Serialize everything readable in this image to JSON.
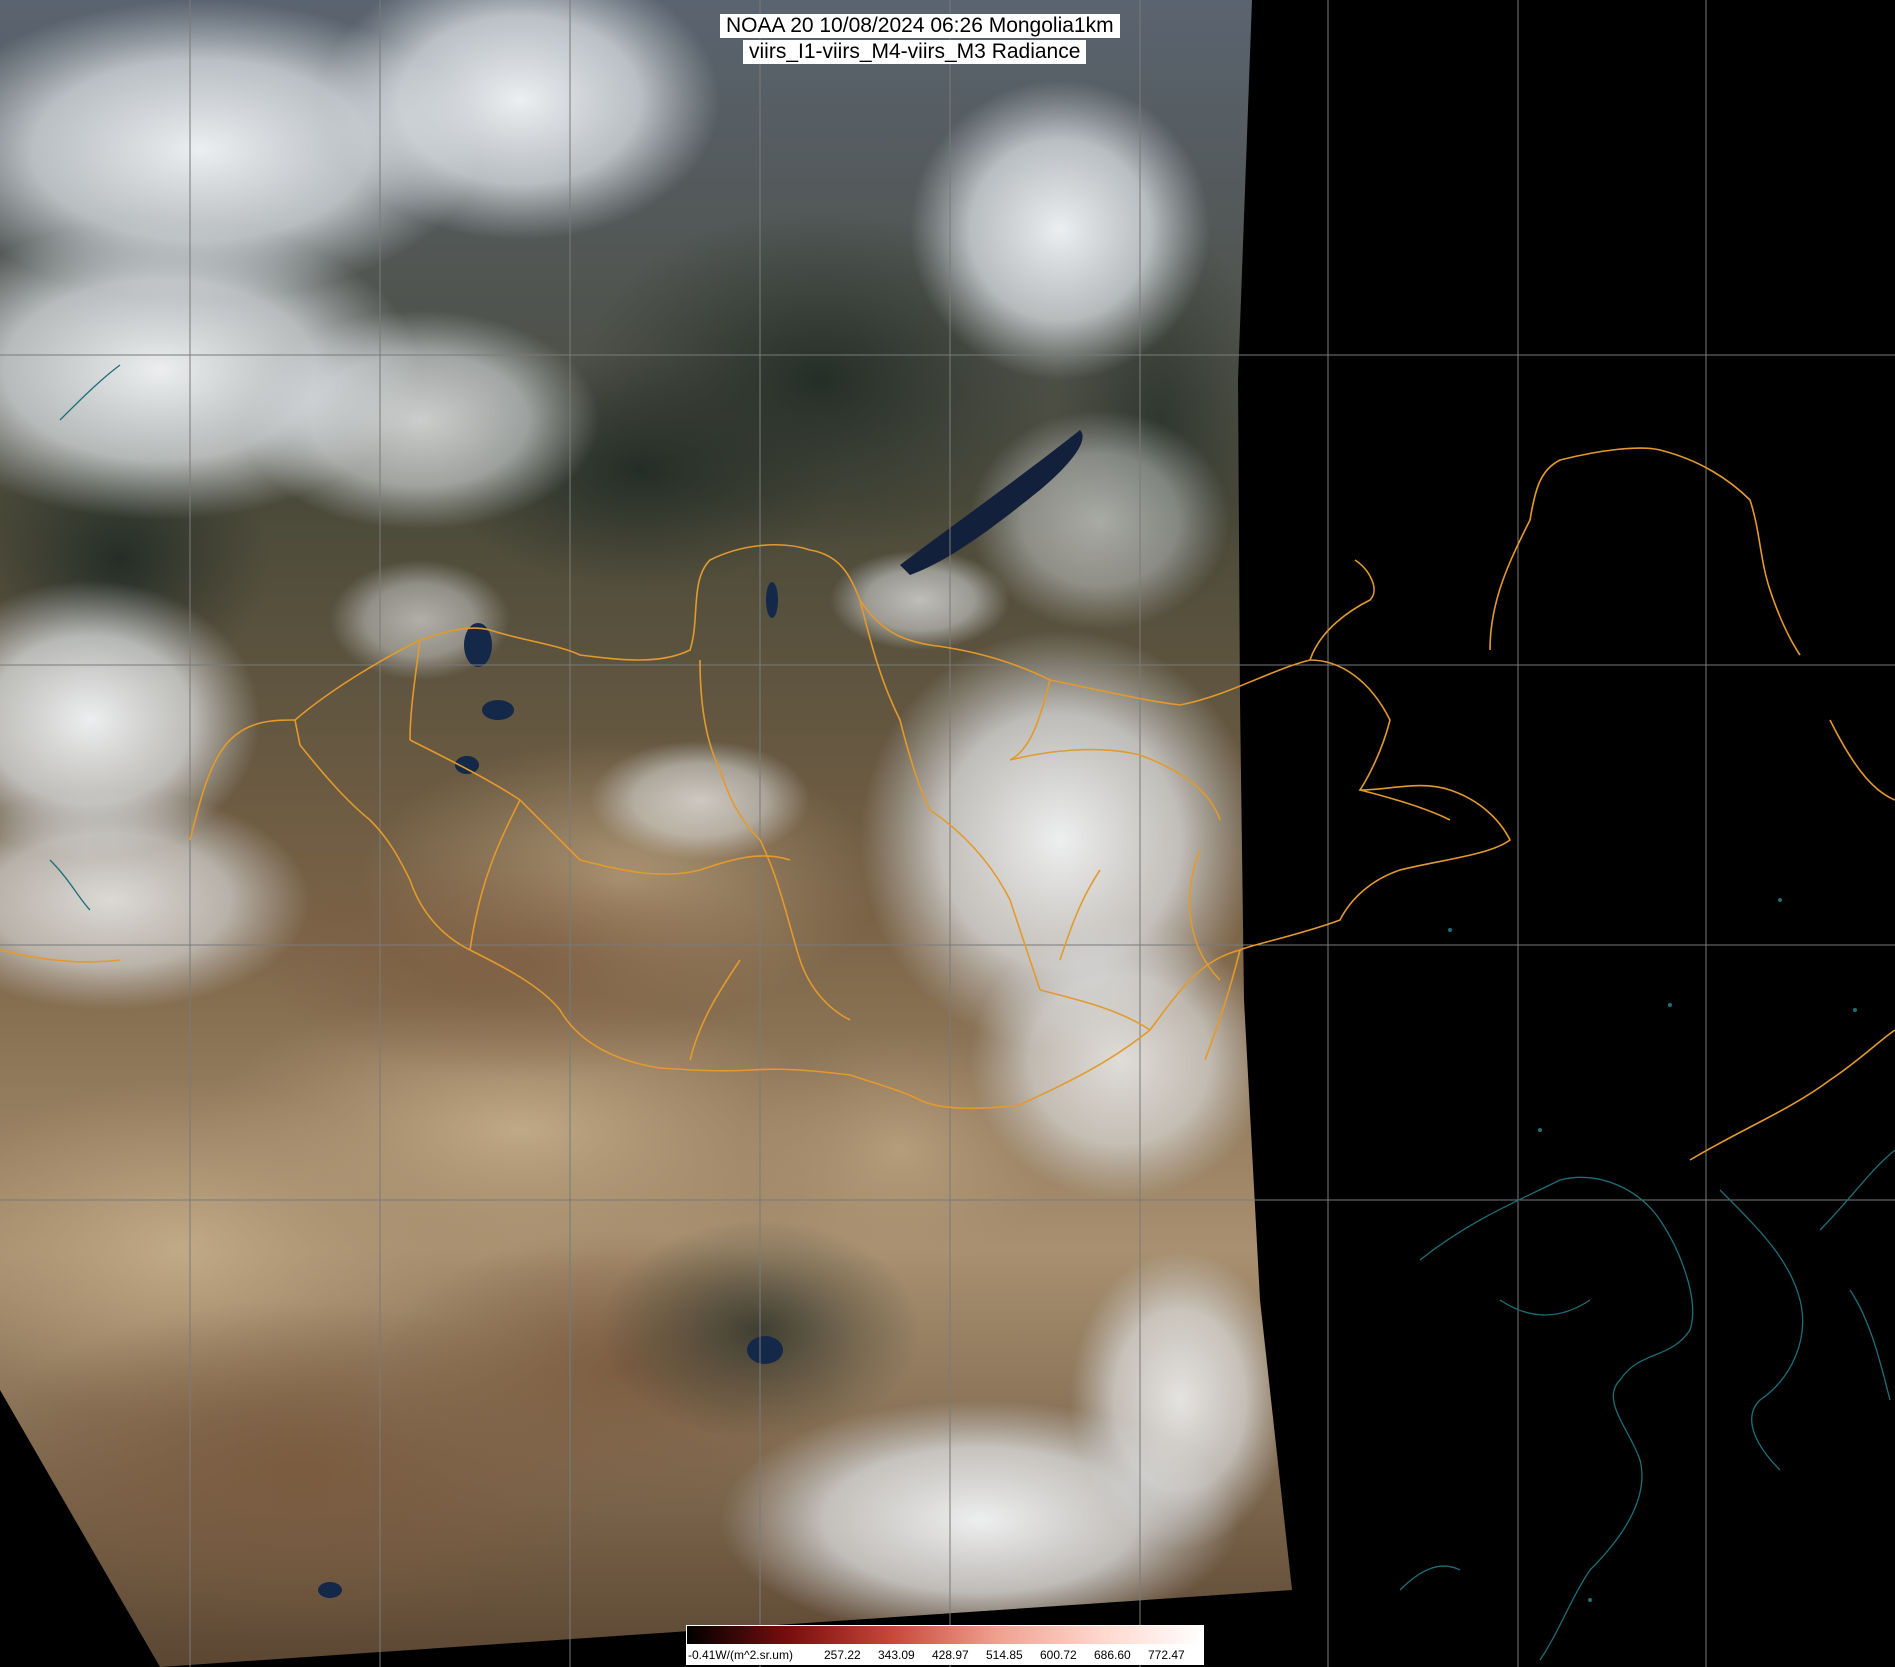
{
  "title": {
    "line1": "NOAA 20 10/08/2024 06:26 Mongolia1km",
    "line2": "viirs_I1-viirs_M4-viirs_M3 Radiance"
  },
  "colorbar": {
    "unit_label": "-0.41W/(m^2.sr.um)",
    "tick_labels": [
      "257.22",
      "343.09",
      "428.97",
      "514.85",
      "600.72",
      "686.60",
      "772.47"
    ],
    "colors": [
      "#000000",
      "#7a0e0e",
      "#c8493a",
      "#f0a090",
      "#ffd6cc",
      "#ffffff"
    ]
  },
  "map": {
    "background_color": "#000000",
    "graticule_color": "#7a7a7a",
    "border_color": "#e39a2c",
    "coastline_color": "#1e6e78",
    "cloud_color": "#eef2f6",
    "desert_color": "#b49a78",
    "vegetation_color": "#3e3a26"
  }
}
